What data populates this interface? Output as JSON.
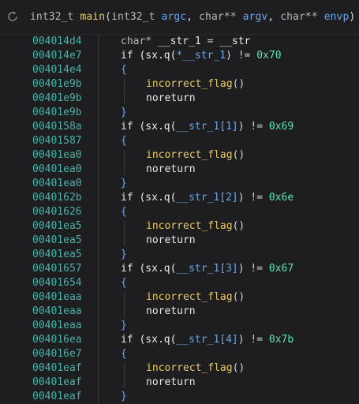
{
  "header": {
    "refresh_icon": "refresh-icon",
    "signature": {
      "ret_type": "int32_t",
      "name": "main",
      "open": "(",
      "p1_type": "int32_t",
      "p1_name": "argc",
      "sep1": ", ",
      "p2_type": "char**",
      "p2_name": "argv",
      "sep2": ", ",
      "p3_type": "char**",
      "p3_name": "envp",
      "close": ")"
    }
  },
  "lines": [
    {
      "addr": "004014d4",
      "kind": "decl",
      "text_type": "char*",
      "text_var": "__str_1",
      "text_eq": " = ",
      "text_val": "__str"
    },
    {
      "addr": "004014e7",
      "kind": "if",
      "pre": "if (sx.q(",
      "arg": "*__str_1",
      "post": ") != ",
      "num": "0x70"
    },
    {
      "addr": "004014e4",
      "kind": "brace",
      "text": "{"
    },
    {
      "addr": "00401e9b",
      "kind": "call",
      "text": "incorrect_flag",
      "parens": "()"
    },
    {
      "addr": "00401e9b",
      "kind": "stmt",
      "text": "noreturn"
    },
    {
      "addr": "00401e9b",
      "kind": "brace",
      "text": "}"
    },
    {
      "addr": "0040158a",
      "kind": "if",
      "pre": "if (sx.q(",
      "arg": "__str_1[1]",
      "post": ") != ",
      "num": "0x69"
    },
    {
      "addr": "00401587",
      "kind": "brace",
      "text": "{"
    },
    {
      "addr": "00401ea0",
      "kind": "call",
      "text": "incorrect_flag",
      "parens": "()"
    },
    {
      "addr": "00401ea0",
      "kind": "stmt",
      "text": "noreturn"
    },
    {
      "addr": "00401ea0",
      "kind": "brace",
      "text": "}"
    },
    {
      "addr": "0040162b",
      "kind": "if",
      "pre": "if (sx.q(",
      "arg": "__str_1[2]",
      "post": ") != ",
      "num": "0x6e"
    },
    {
      "addr": "00401626",
      "kind": "brace",
      "text": "{"
    },
    {
      "addr": "00401ea5",
      "kind": "call",
      "text": "incorrect_flag",
      "parens": "()"
    },
    {
      "addr": "00401ea5",
      "kind": "stmt",
      "text": "noreturn"
    },
    {
      "addr": "00401ea5",
      "kind": "brace",
      "text": "}"
    },
    {
      "addr": "00401657",
      "kind": "if",
      "pre": "if (sx.q(",
      "arg": "__str_1[3]",
      "post": ") != ",
      "num": "0x67"
    },
    {
      "addr": "00401654",
      "kind": "brace",
      "text": "{"
    },
    {
      "addr": "00401eaa",
      "kind": "call",
      "text": "incorrect_flag",
      "parens": "()"
    },
    {
      "addr": "00401eaa",
      "kind": "stmt",
      "text": "noreturn"
    },
    {
      "addr": "00401eaa",
      "kind": "brace",
      "text": "}"
    },
    {
      "addr": "004016ea",
      "kind": "if",
      "pre": "if (sx.q(",
      "arg": "__str_1[4]",
      "post": ") != ",
      "num": "0x7b"
    },
    {
      "addr": "004016e7",
      "kind": "brace",
      "text": "{"
    },
    {
      "addr": "00401eaf",
      "kind": "call",
      "text": "incorrect_flag",
      "parens": "()"
    },
    {
      "addr": "00401eaf",
      "kind": "stmt",
      "text": "noreturn"
    },
    {
      "addr": "00401eaf",
      "kind": "brace",
      "text": "}"
    }
  ]
}
